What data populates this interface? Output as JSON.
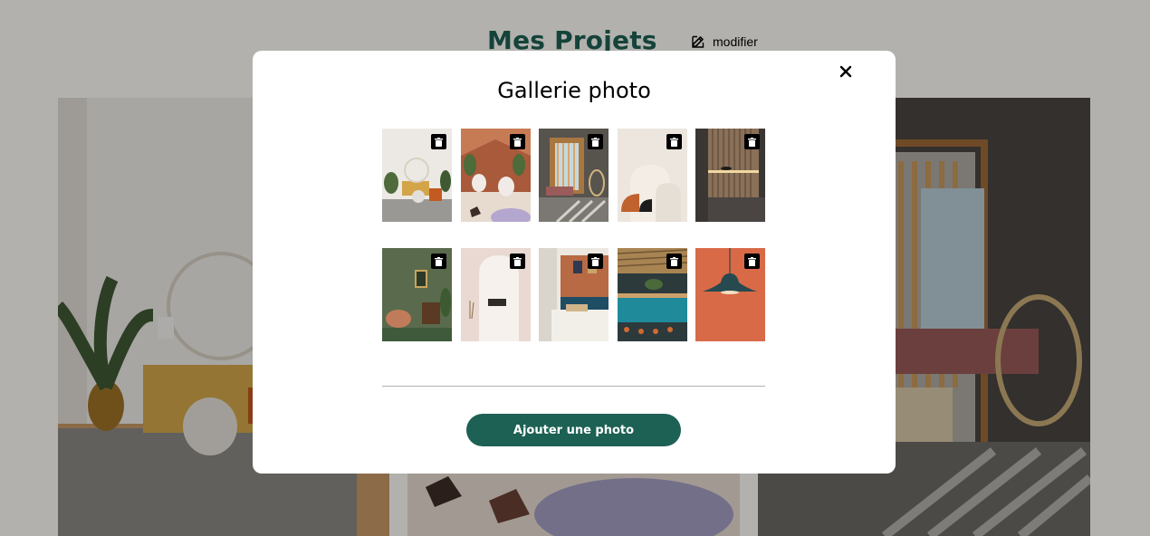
{
  "background_page": {
    "title": "Mes Projets",
    "edit_label": "modifier"
  },
  "modal": {
    "title": "Gallerie photo",
    "close_icon": "close-icon",
    "photos": [
      {
        "subject": "living room with plants and orange sofa"
      },
      {
        "subject": "restaurant with terrazzo floor and plants"
      },
      {
        "subject": "room with wooden slats and hanging chair"
      },
      {
        "subject": "beige arches and terracotta shapes"
      },
      {
        "subject": "minimal kitchen with wood panel wall"
      },
      {
        "subject": "green living room with framed art"
      },
      {
        "subject": "white arched alcove with pink wall"
      },
      {
        "subject": "bedroom with terracotta wall and artwork"
      },
      {
        "subject": "bar with teal counter and wooden ceiling"
      },
      {
        "subject": "dark pendant lamp on orange wall"
      }
    ],
    "delete_icon": "trash-icon",
    "add_photo_label": "Ajouter une photo"
  },
  "colors": {
    "brand_green": "#1d6154",
    "overlay": "rgba(0,0,0,0.30)",
    "modal_bg": "#ffffff"
  }
}
